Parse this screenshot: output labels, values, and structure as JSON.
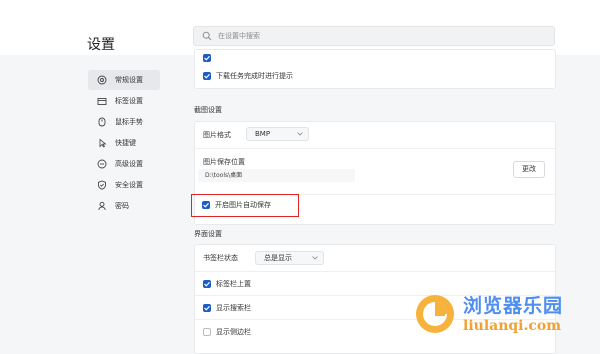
{
  "page": {
    "title": "设置"
  },
  "search": {
    "placeholder": "在设置中搜索"
  },
  "sidebar": {
    "items": [
      {
        "label": "常规设置",
        "icon": "settings-icon",
        "active": true
      },
      {
        "label": "标签设置",
        "icon": "tab-icon",
        "active": false
      },
      {
        "label": "鼠标手势",
        "icon": "mouse-gesture-icon",
        "active": false
      },
      {
        "label": "快捷键",
        "icon": "shortcut-icon",
        "active": false
      },
      {
        "label": "高级设置",
        "icon": "advanced-icon",
        "active": false
      },
      {
        "label": "安全设置",
        "icon": "shield-icon",
        "active": false
      },
      {
        "label": "密码",
        "icon": "key-icon",
        "active": false
      }
    ]
  },
  "download": {
    "notify_label": "下载任务完成时进行提示",
    "notify_checked": true
  },
  "screenshot": {
    "section_title": "截图设置",
    "format_label": "图片格式",
    "format_value": "BMP",
    "save_location_label": "图片保存位置",
    "save_path": "D:\\tools\\桌面",
    "change_button": "更改",
    "auto_save_label": "开启图片自动保存",
    "auto_save_checked": true
  },
  "interface": {
    "section_title": "界面设置",
    "tabbar_state_label": "书签栏状态",
    "tabbar_state_value": "总是显示",
    "tabs_on_top_label": "标签栏上置",
    "tabs_on_top_checked": true,
    "show_search_bar_label": "显示搜索栏",
    "show_search_bar_checked": true,
    "show_sidebar_label": "显示侧边栏",
    "show_sidebar_checked": false
  },
  "watermark": {
    "title": "浏览器乐园",
    "url": "liulanqi.com"
  },
  "colors": {
    "accent": "#1a5cc4",
    "highlight": "#e02424"
  }
}
